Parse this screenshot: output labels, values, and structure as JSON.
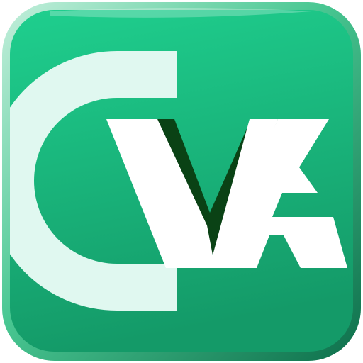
{
  "app_icon": {
    "logo_text": "CVA",
    "colors": {
      "bevel_light": "#c4efdc",
      "bevel_mid": "#49c792",
      "bevel_dark": "#0e6f4b",
      "face_top": "#1fcf8e",
      "face_bottom": "#149a68",
      "letter_c": "#e0f8f0",
      "letter_va": "#ffffff",
      "v_shadow": "#0a4215"
    }
  }
}
